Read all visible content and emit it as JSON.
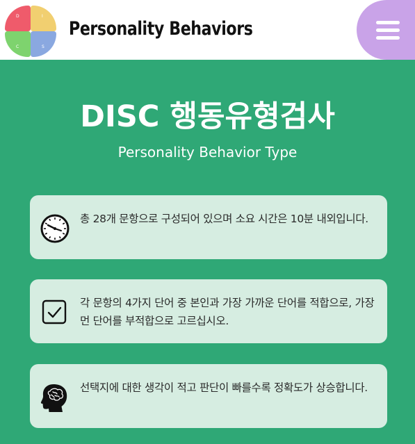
{
  "header": {
    "logo_letters": {
      "d": "D",
      "i": "I",
      "c": "C",
      "s": "S"
    },
    "brand": "Personality Behaviors",
    "menu_icon": "hamburger-menu-icon"
  },
  "hero": {
    "title": "DISC 행동유형검사",
    "subtitle": "Personality Behavior Type"
  },
  "cards": [
    {
      "icon": "clock-icon",
      "text": "총 28개 문항으로 구성되어 있으며 소요 시간은 10분 내외입니다."
    },
    {
      "icon": "checkbox-icon",
      "text": "각 문항의 4가지 단어 중 본인과 가장 가까운 단어를 적합으로, 가장 먼 단어를 부적합으로 고르십시오."
    },
    {
      "icon": "brain-head-icon",
      "text": "선택지에 대한 생각이 적고 판단이 빠를수록 정확도가 상승합니다."
    }
  ],
  "colors": {
    "background": "#2fa876",
    "card": "#d6ede1",
    "menu": "#c9a3e8",
    "logo_d": "#ef5b6b",
    "logo_i": "#f1cf70",
    "logo_c": "#7ed36e",
    "logo_s": "#8aa8e0"
  }
}
